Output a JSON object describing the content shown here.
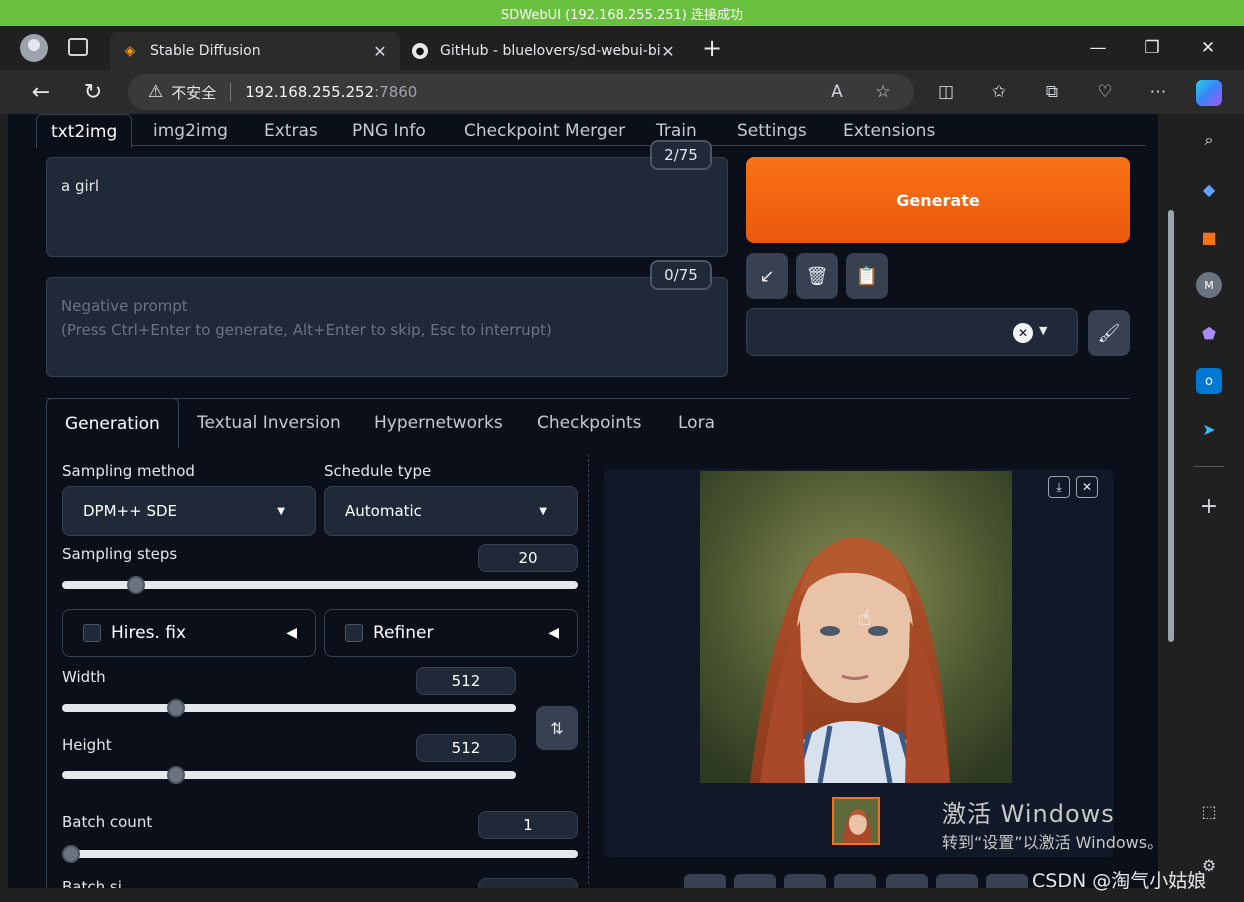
{
  "notification": "SDWebUI (192.168.255.251) 连接成功",
  "browser": {
    "tabs": [
      {
        "title": "Stable Diffusion"
      },
      {
        "title": "GitHub - bluelovers/sd-webui-bi"
      }
    ],
    "address": {
      "security": "不安全",
      "host": "192.168.255.252",
      "port": ":7860"
    }
  },
  "webui": {
    "tabs": [
      "txt2img",
      "img2img",
      "Extras",
      "PNG Info",
      "Checkpoint Merger",
      "Train",
      "Settings",
      "Extensions"
    ],
    "prompt": {
      "value": "a girl",
      "counter": "2/75"
    },
    "negative_prompt": {
      "placeholder_line1": "Negative prompt",
      "placeholder_line2": "(Press Ctrl+Enter to generate, Alt+Enter to skip, Esc to interrupt)",
      "counter": "0/75"
    },
    "generate_label": "Generate",
    "lower_tabs": [
      "Generation",
      "Textual Inversion",
      "Hypernetworks",
      "Checkpoints",
      "Lora"
    ],
    "sampling_method": {
      "label": "Sampling method",
      "value": "DPM++ SDE"
    },
    "schedule_type": {
      "label": "Schedule type",
      "value": "Automatic"
    },
    "sampling_steps": {
      "label": "Sampling steps",
      "value": "20",
      "fraction": 0.13
    },
    "hires_fix": "Hires. fix",
    "refiner": "Refiner",
    "width": {
      "label": "Width",
      "value": "512",
      "fraction": 0.24
    },
    "height": {
      "label": "Height",
      "value": "512",
      "fraction": 0.24
    },
    "batch_count": {
      "label": "Batch count",
      "value": "1",
      "fraction": 0.0
    },
    "batch_size_partial": "Batch si"
  },
  "watermark": {
    "title": "激活 Windows",
    "subtitle": "转到“设置”以激活 Windows。"
  },
  "csdn": "CSDN @淘气小姑娘",
  "colors": {
    "accent": "#f97316",
    "notify": "#6ac13f",
    "page_bg": "#0b0f19"
  }
}
